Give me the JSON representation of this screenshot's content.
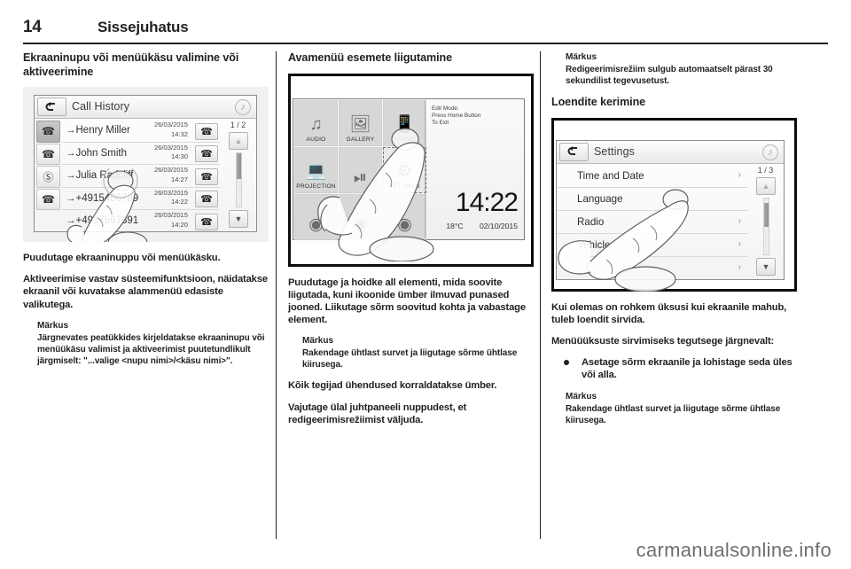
{
  "header": {
    "page_number": "14",
    "chapter_title": "Sissejuhatus"
  },
  "watermark": "carmanualsonline.info",
  "columns": {
    "left": {
      "heading": "Ekraaninupu või menüükäsu valimine või aktiveerimine",
      "paragraphs": [
        "Puudutage ekraaninuppu või menüükäsku.",
        "Aktiveerimise vastav süsteemifunktsioon, näidatakse ekraanil või kuvatakse alammenüü edasiste valikutega."
      ],
      "note": {
        "label": "Märkus",
        "text": "Järgnevates peatükkides kirjeldatakse ekraaninupu või menüükäsu valimist ja aktiveerimist puutetundlikult järgmiselt: \"...valige <nupu nimi>/<käsu nimi>\"."
      },
      "figure": {
        "name": "call-history-screen",
        "titlebar": "Call History",
        "back_icon": "back-arrow-icon",
        "note_icon": "music-note-icon",
        "page_indicator": "1 / 2",
        "side_icons": [
          "all-calls-icon",
          "outgoing-calls-icon",
          "missed-calls-icon",
          "incoming-calls-icon"
        ],
        "rows": [
          {
            "name": "→Henry Miller",
            "date": "26/03/2015",
            "time": "14:32",
            "dial_icon": "phone-handset-icon"
          },
          {
            "name": "→John Smith",
            "date": "26/03/2015",
            "time": "14:30",
            "dial_icon": "phone-handset-icon"
          },
          {
            "name": "→Julia Radcliff",
            "date": "26/03/2015",
            "time": "14:27",
            "dial_icon": "phone-handset-icon"
          },
          {
            "name": "→+4915456789",
            "date": "26/03/2015",
            "time": "14:22",
            "dial_icon": "phone-handset-icon"
          },
          {
            "name": "→+4917567891",
            "date": "26/03/2015",
            "time": "14:20",
            "dial_icon": "phone-handset-icon"
          }
        ],
        "scroll_up_icon": "triangle-up-icon",
        "scroll_down_icon": "triangle-down-icon"
      }
    },
    "middle": {
      "heading": "Avamenüü esemete liigutamine",
      "paragraphs": [
        "Puudutage ja hoidke all elementi, mida soovite liigutada, kuni ikoonide ümber ilmuvad punased jooned. Liikutage sõrm soovitud kohta ja vabastage element."
      ],
      "note": {
        "label": "Märkus",
        "text": "Rakendage ühtlast survet ja liigutage sõrme ühtlase kiirusega."
      },
      "paragraphs_after": [
        "Kõik tegijad ühendused korraldatakse ümber.",
        "Vajutage ülal juhtpaneeli nuppudest, et redigeerimisrežiimist väljuda."
      ],
      "figure": {
        "name": "home-screen-edit-mode",
        "edit_mode_text": "Edit Mode:\nPress Home Button\nTo Exit",
        "clock": "14:22",
        "temperature": "18°C",
        "date": "02/10/2015",
        "tiles": [
          {
            "label": "AUDIO",
            "icon": "audio-note-icon"
          },
          {
            "label": "GALLERY",
            "icon": "gallery-photos-icon"
          },
          {
            "label": "PHONE",
            "icon": "phone-device-icon"
          },
          {
            "label": "PROJECTION",
            "icon": "projection-screen-icon"
          },
          {
            "label": "",
            "icon": "navigation-icon"
          },
          {
            "label": "SETTINGS",
            "icon": "gear-icon"
          }
        ]
      }
    },
    "right": {
      "note_top": {
        "label": "Märkus",
        "text": "Redigeerimisrežiim sulgub automaatselt pärast 30 sekundilist tegevusetust."
      },
      "heading": "Loendite kerimine",
      "paragraphs": [
        "Kui olemas on rohkem üksusi kui ekraanile mahub, tuleb loendit sirvida.",
        "Menüüüksuste sirvimiseks tegutsege järgnevalt:"
      ],
      "bullets": [
        "Asetage sõrm ekraanile ja lohistage seda üles või alla."
      ],
      "note_bottom": {
        "label": "Märkus",
        "text": "Rakendage ühtlast survet ja liigutage sõrme ühtlase kiirusega."
      },
      "figure": {
        "name": "settings-screen",
        "titlebar": "Settings",
        "back_icon": "back-arrow-icon",
        "note_icon": "music-note-icon",
        "page_indicator": "1 / 3",
        "rows": [
          {
            "label": "Time and Date",
            "chevron": "chevron-right-icon"
          },
          {
            "label": "Language",
            "chevron": ""
          },
          {
            "label": "Radio",
            "chevron": "chevron-right-icon"
          },
          {
            "label": "Vehicle",
            "chevron": "chevron-right-icon"
          },
          {
            "label": "",
            "chevron": "chevron-right-icon"
          }
        ],
        "scroll_up_icon": "triangle-up-icon",
        "scroll_down_icon": "triangle-down-icon"
      }
    }
  },
  "colors": {
    "ink": "#231f20",
    "screen_bg": "#f3f3f3",
    "tile_bg": "#d7d7d7",
    "watermark": "#6f6f6f"
  }
}
